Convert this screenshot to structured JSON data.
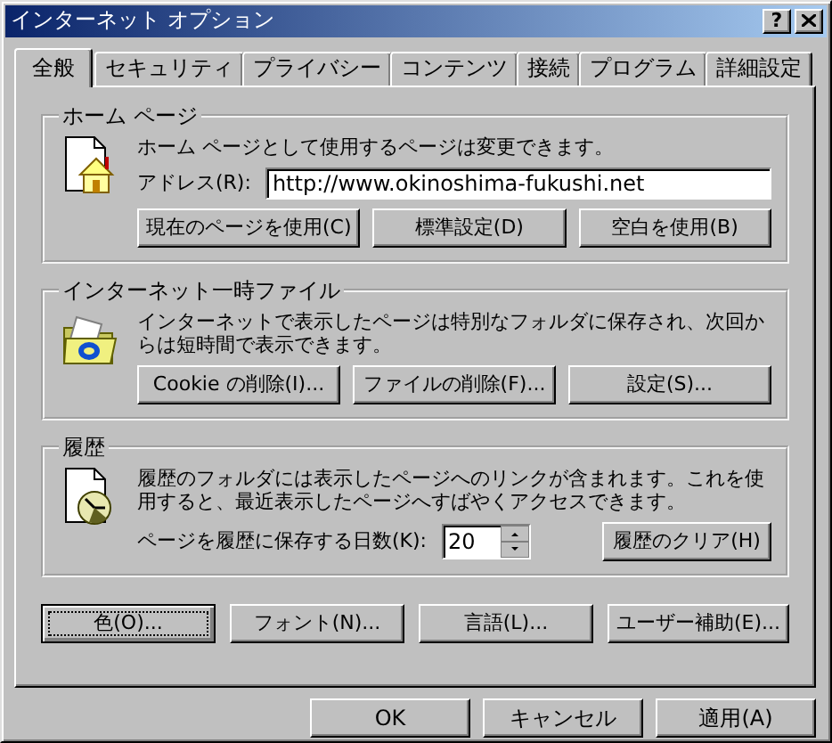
{
  "window": {
    "title": "インターネット オプション",
    "help_button": "?"
  },
  "tabs": [
    {
      "label": "全般",
      "selected": true
    },
    {
      "label": "セキュリティ",
      "selected": false
    },
    {
      "label": "プライバシー",
      "selected": false
    },
    {
      "label": "コンテンツ",
      "selected": false
    },
    {
      "label": "接続",
      "selected": false
    },
    {
      "label": "プログラム",
      "selected": false
    },
    {
      "label": "詳細設定",
      "selected": false
    }
  ],
  "home_page": {
    "title": "ホーム ページ",
    "description": "ホーム ページとして使用するページは変更できます。",
    "address_label": "アドレス(R):",
    "address_value": "http://www.okinoshima-fukushi.net",
    "buttons": [
      "現在のページを使用(C)",
      "標準設定(D)",
      "空白を使用(B)"
    ]
  },
  "temporary_files": {
    "title": "インターネット一時ファイル",
    "description": "インターネットで表示したページは特別なフォルダに保存され、次回からは短時間で表示できます。",
    "buttons": [
      "Cookie の削除(I)...",
      "ファイルの削除(F)...",
      "設定(S)..."
    ]
  },
  "history": {
    "title": "履歴",
    "description": "履歴のフォルダには表示したページへのリンクが含まれます。これを使用すると、最近表示したページへすばやくアクセスできます。",
    "days_label": "ページを履歴に保存する日数(K):",
    "days_value": "20",
    "clear_button": "履歴のクリア(H)"
  },
  "appearance_buttons": [
    {
      "label": "色(O)...",
      "focused": true
    },
    {
      "label": "フォント(N)...",
      "focused": false
    },
    {
      "label": "言語(L)...",
      "focused": false
    },
    {
      "label": "ユーザー補助(E)...",
      "focused": false
    }
  ],
  "dialog_buttons": [
    "OK",
    "キャンセル",
    "適用(A)"
  ]
}
